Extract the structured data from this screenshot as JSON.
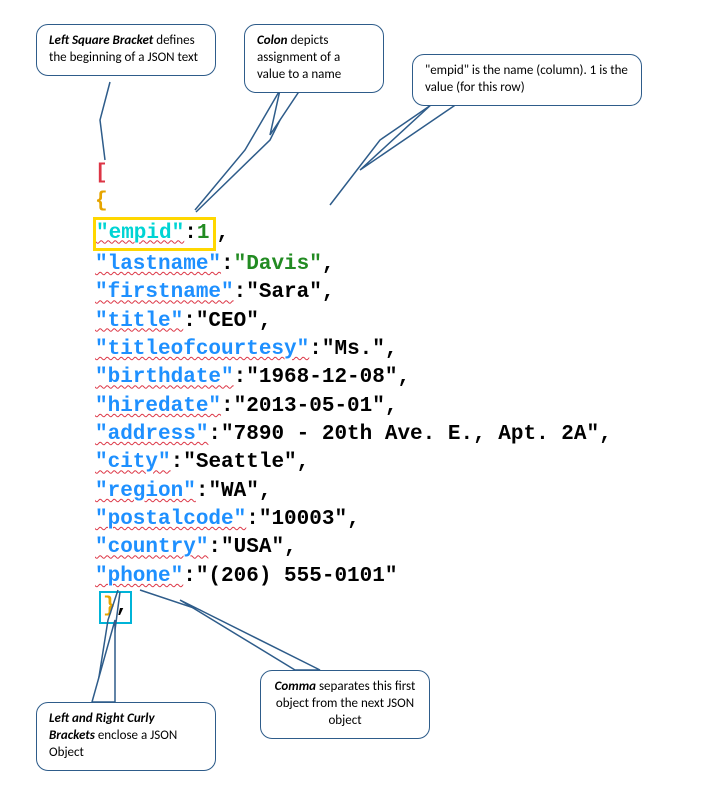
{
  "callouts": {
    "leftBracket": "Left Square Bracket",
    "leftBracketText": " defines the beginning of a JSON text",
    "colon": "Colon",
    "colonText": " depicts assignment of a value to a name",
    "empid": "\"empid\" is the name (column). 1 is the value (for this row)",
    "curlyBrackets": "Left and Right Curly Brackets",
    "curlyBracketsText": " enclose a JSON Object",
    "comma": "Comma",
    "commaText": " separates this first object from the next JSON object"
  },
  "code": {
    "openBracket": "[",
    "openBrace": "{",
    "lines": [
      {
        "key": "\"empid\"",
        "sep": ":",
        "val": "1",
        "type": "num",
        "hl": true
      },
      {
        "key": "\"lastname\"",
        "sep": ":",
        "val": "\"Davis\"",
        "type": "strhl"
      },
      {
        "key": "\"firstname\"",
        "sep": ":",
        "val": "\"Sara\"",
        "type": "str"
      },
      {
        "key": "\"title\"",
        "sep": ":",
        "val": "\"CEO\"",
        "type": "str"
      },
      {
        "key": "\"titleofcourtesy\"",
        "sep": ":",
        "val": "\"Ms.\"",
        "type": "str"
      },
      {
        "key": "\"birthdate\"",
        "sep": ":",
        "val": "\"1968-12-08\"",
        "type": "str"
      },
      {
        "key": "\"hiredate\"",
        "sep": ":",
        "val": "\"2013-05-01\"",
        "type": "str"
      },
      {
        "key": "\"address\"",
        "sep": ":",
        "val": "\"7890 - 20th Ave. E., Apt. 2A\"",
        "type": "str"
      },
      {
        "key": "\"city\"",
        "sep": ":",
        "val": "\"Seattle\"",
        "type": "str"
      },
      {
        "key": "\"region\"",
        "sep": ":",
        "val": "\"WA\"",
        "type": "str"
      },
      {
        "key": "\"postalcode\"",
        "sep": ":",
        "val": "\"10003\"",
        "type": "str"
      },
      {
        "key": "\"country\"",
        "sep": ":",
        "val": "\"USA\"",
        "type": "str"
      },
      {
        "key": "\"phone\"",
        "sep": ":",
        "val": "\"(206) 555-0101\"",
        "type": "str",
        "nocomma": true
      }
    ],
    "closeBrace": "}",
    "closeComma": ","
  }
}
